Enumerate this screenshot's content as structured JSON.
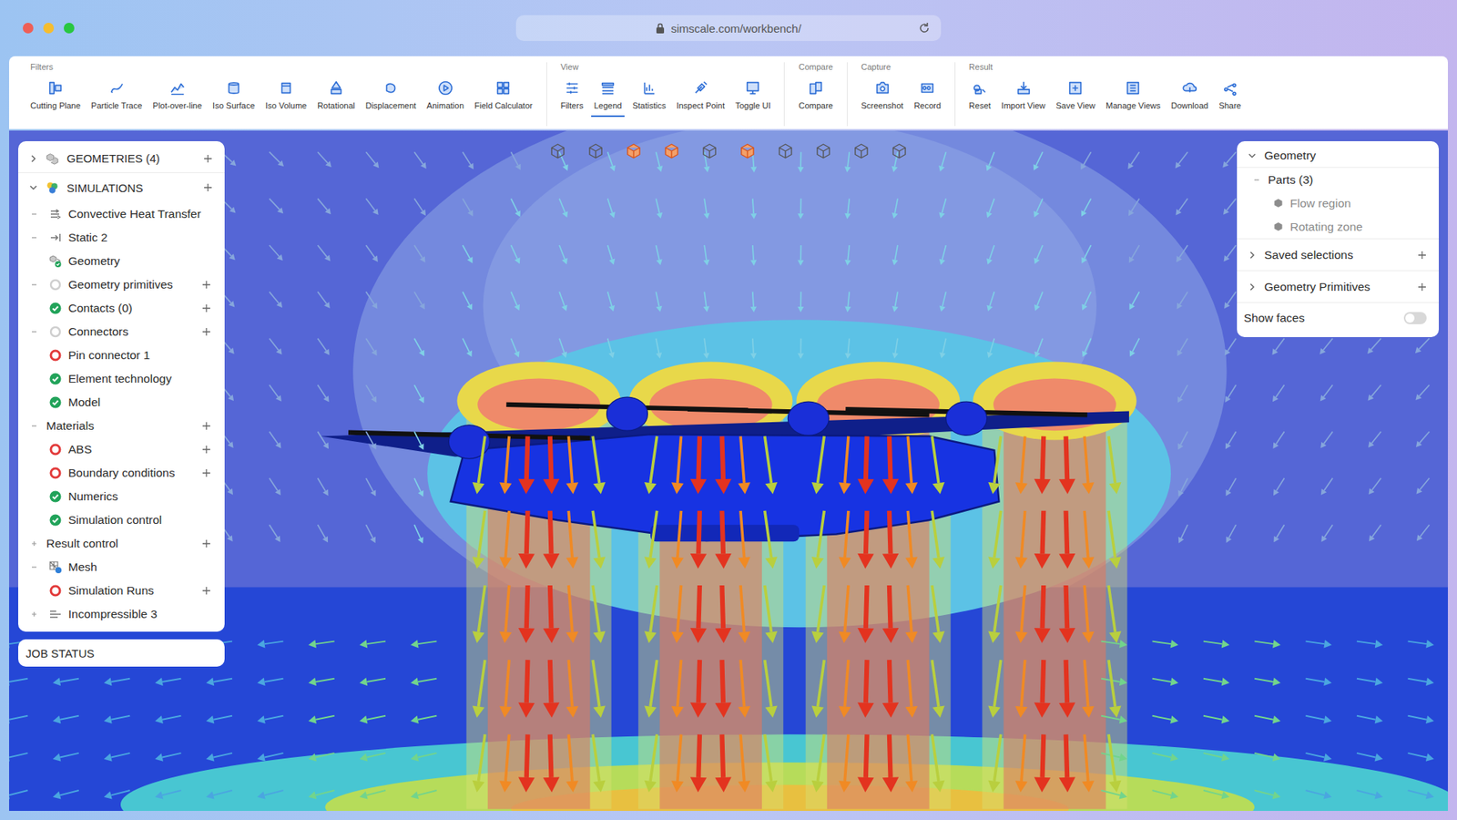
{
  "window": {
    "url": "simscale.com/workbench/"
  },
  "toolbar": {
    "groups": [
      {
        "title": "Filters",
        "buttons": [
          {
            "label": "Cutting Plane",
            "selected": false
          },
          {
            "label": "Particle Trace",
            "selected": false
          },
          {
            "label": "Plot-over-line",
            "selected": false
          },
          {
            "label": "Iso Surface",
            "selected": false
          },
          {
            "label": "Iso Volume",
            "selected": false
          },
          {
            "label": "Rotational",
            "selected": false
          },
          {
            "label": "Displacement",
            "selected": false
          },
          {
            "label": "Animation",
            "selected": false
          },
          {
            "label": "Field Calculator",
            "selected": false
          }
        ]
      },
      {
        "title": "View",
        "buttons": [
          {
            "label": "Filters",
            "selected": false
          },
          {
            "label": "Legend",
            "selected": true
          },
          {
            "label": "Statistics",
            "selected": false
          },
          {
            "label": "Inspect Point",
            "selected": false
          },
          {
            "label": "Toggle UI",
            "selected": false
          }
        ]
      },
      {
        "title": "Compare",
        "buttons": [
          {
            "label": "Compare",
            "selected": false
          }
        ]
      },
      {
        "title": "Capture",
        "buttons": [
          {
            "label": "Screenshot",
            "selected": false
          },
          {
            "label": "Record",
            "selected": false
          }
        ]
      },
      {
        "title": "Result",
        "buttons": [
          {
            "label": "Reset",
            "selected": false
          },
          {
            "label": "Import View",
            "selected": false
          },
          {
            "label": "Save View",
            "selected": false
          },
          {
            "label": "Manage Views",
            "selected": false
          },
          {
            "label": "Download",
            "selected": false
          },
          {
            "label": "Share",
            "selected": false
          }
        ]
      }
    ]
  },
  "viewport_tools": [
    {
      "highlighted": false
    },
    {
      "highlighted": false
    },
    {
      "highlighted": true
    },
    {
      "highlighted": true
    },
    {
      "highlighted": false
    },
    {
      "highlighted": true
    },
    {
      "highlighted": false
    },
    {
      "highlighted": false
    },
    {
      "highlighted": false
    },
    {
      "highlighted": false
    }
  ],
  "simulation_tree": {
    "sections": [
      {
        "label": "GEOMETRIES (4)",
        "expanded": false
      },
      {
        "label": "SIMULATIONS",
        "expanded": true
      }
    ],
    "items": [
      {
        "label": "Convective Heat Transfer",
        "expandable": true,
        "expanded": true,
        "icon": "sim",
        "add": false
      },
      {
        "label": "Static 2",
        "expandable": true,
        "expanded": true,
        "icon": "static",
        "add": false
      },
      {
        "label": "Geometry",
        "expandable": false,
        "expanded": false,
        "icon": "geometry",
        "add": false
      },
      {
        "label": "Geometry primitives",
        "expandable": true,
        "expanded": true,
        "icon": "empty",
        "add": true
      },
      {
        "label": "Contacts (0)",
        "expandable": false,
        "expanded": false,
        "icon": "ok",
        "add": true
      },
      {
        "label": "Connectors",
        "expandable": true,
        "expanded": true,
        "icon": "empty",
        "add": true
      },
      {
        "label": "Pin connector 1",
        "expandable": false,
        "expanded": false,
        "icon": "error",
        "add": false
      },
      {
        "label": "Element technology",
        "expandable": false,
        "expanded": false,
        "icon": "ok",
        "add": false
      },
      {
        "label": "Model",
        "expandable": false,
        "expanded": false,
        "icon": "ok",
        "add": false
      },
      {
        "label": "Materials",
        "expandable": true,
        "expanded": true,
        "icon": "none",
        "add": true
      },
      {
        "label": "ABS",
        "expandable": false,
        "expanded": false,
        "icon": "error",
        "add": true
      },
      {
        "label": "Boundary conditions",
        "expandable": false,
        "expanded": false,
        "icon": "error",
        "add": true
      },
      {
        "label": "Numerics",
        "expandable": false,
        "expanded": false,
        "icon": "ok",
        "add": false
      },
      {
        "label": "Simulation control",
        "expandable": false,
        "expanded": false,
        "icon": "ok",
        "add": false
      },
      {
        "label": "Result control",
        "expandable": true,
        "expanded": false,
        "icon": "none",
        "add": true
      },
      {
        "label": "Mesh",
        "expandable": true,
        "expanded": true,
        "icon": "mesh",
        "add": false
      },
      {
        "label": "Simulation Runs",
        "expandable": false,
        "expanded": false,
        "icon": "error",
        "add": true
      },
      {
        "label": "Incompressible 3",
        "expandable": true,
        "expanded": false,
        "icon": "incompressible",
        "add": false
      }
    ]
  },
  "job_status": {
    "label": "JOB STATUS"
  },
  "geometry_panel": {
    "title": "Geometry",
    "expanded": true,
    "parts": {
      "label": "Parts (3)",
      "expanded": true,
      "items": [
        {
          "label": "Flow region",
          "dimmed": true
        },
        {
          "label": "Rotating zone",
          "dimmed": true
        }
      ]
    },
    "sections": [
      {
        "label": "Saved selections",
        "expanded": false
      },
      {
        "label": "Geometry Primitives",
        "expanded": false
      }
    ],
    "toggle": {
      "label": "Show faces",
      "on": false
    }
  }
}
